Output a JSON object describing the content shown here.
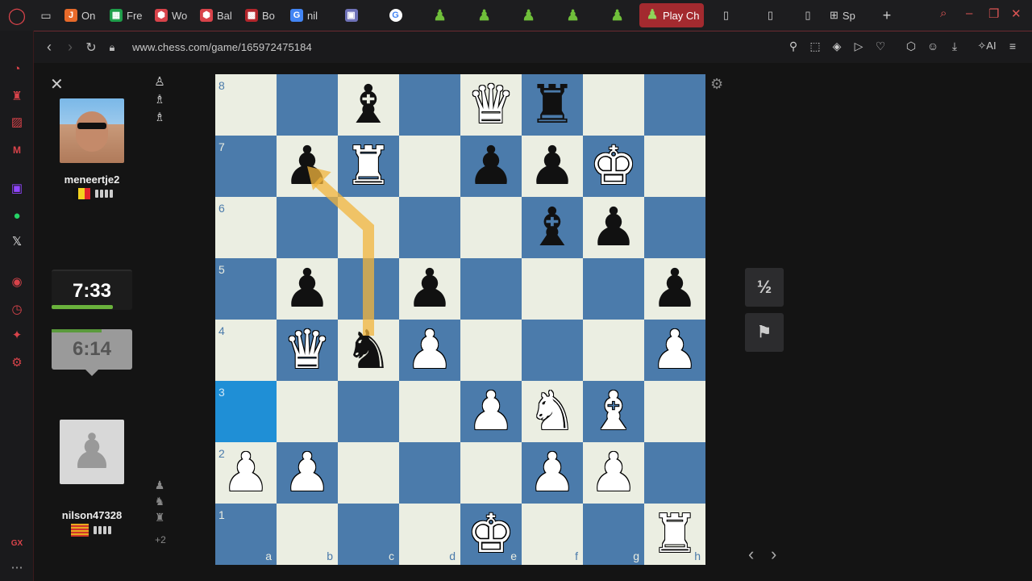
{
  "tabs": [
    {
      "label": "On",
      "icon": "jira-icon",
      "color": "#e86a2a",
      "glyph": "J"
    },
    {
      "label": "Fre",
      "icon": "sheet-icon",
      "color": "#1e9e4a",
      "glyph": "▦"
    },
    {
      "label": "Wo",
      "icon": "red-hex-icon",
      "color": "#d8434a",
      "glyph": "⬢"
    },
    {
      "label": "Bal",
      "icon": "red-hex-icon",
      "color": "#d8434a",
      "glyph": "⬢"
    },
    {
      "label": "Bo",
      "icon": "checker-icon",
      "color": "#b3262c",
      "glyph": "▩"
    },
    {
      "label": "nil",
      "icon": "google-icon",
      "color": "#4285f4",
      "glyph": "G"
    }
  ],
  "active_tab": {
    "label": "Play Ch"
  },
  "spaces_tab": {
    "label": "Sp"
  },
  "address": {
    "url": "www.chess.com/game/165972475184"
  },
  "toolbar": {
    "ai_label": "AI"
  },
  "top_player": {
    "name": "meneertje2",
    "clock": "7:33"
  },
  "bottom_player": {
    "name": "nilson47328",
    "clock": "6:14",
    "captures_extra": "+2"
  },
  "draw_label": "½",
  "colors": {
    "light_square": "#ebeee2",
    "dark_square": "#4b7bab",
    "highlight": "#1f8fd6",
    "arrow": "#f2b43c",
    "accent": "#d8434a"
  },
  "board": {
    "rank_labels": [
      "8",
      "7",
      "6",
      "5",
      "4",
      "3",
      "2",
      "1"
    ],
    "file_labels": [
      "a",
      "b",
      "c",
      "d",
      "e",
      "f",
      "g",
      "h"
    ],
    "pieces": [
      {
        "sq": "c8",
        "piece": "bishop",
        "color": "black"
      },
      {
        "sq": "e8",
        "piece": "queen",
        "color": "white"
      },
      {
        "sq": "f8",
        "piece": "rook",
        "color": "black"
      },
      {
        "sq": "b7",
        "piece": "pawn",
        "color": "black"
      },
      {
        "sq": "c7",
        "piece": "rook",
        "color": "white"
      },
      {
        "sq": "e7",
        "piece": "pawn",
        "color": "black"
      },
      {
        "sq": "f7",
        "piece": "pawn",
        "color": "black"
      },
      {
        "sq": "g7",
        "piece": "king",
        "color": "white"
      },
      {
        "sq": "f6",
        "piece": "bishop",
        "color": "black"
      },
      {
        "sq": "g6",
        "piece": "pawn",
        "color": "black"
      },
      {
        "sq": "b5",
        "piece": "pawn",
        "color": "black"
      },
      {
        "sq": "d5",
        "piece": "pawn",
        "color": "black"
      },
      {
        "sq": "h5",
        "piece": "pawn",
        "color": "black"
      },
      {
        "sq": "b4",
        "piece": "queen",
        "color": "white"
      },
      {
        "sq": "c4",
        "piece": "knight",
        "color": "black"
      },
      {
        "sq": "d4",
        "piece": "pawn",
        "color": "white"
      },
      {
        "sq": "h4",
        "piece": "pawn",
        "color": "white"
      },
      {
        "sq": "e3",
        "piece": "pawn",
        "color": "white"
      },
      {
        "sq": "f3",
        "piece": "knight",
        "color": "white"
      },
      {
        "sq": "g3",
        "piece": "bishop",
        "color": "white"
      },
      {
        "sq": "a2",
        "piece": "pawn",
        "color": "white"
      },
      {
        "sq": "b2",
        "piece": "pawn",
        "color": "white"
      },
      {
        "sq": "f2",
        "piece": "pawn",
        "color": "white"
      },
      {
        "sq": "g2",
        "piece": "pawn",
        "color": "white"
      },
      {
        "sq": "e1",
        "piece": "king",
        "color": "white"
      },
      {
        "sq": "h1",
        "piece": "rook",
        "color": "white"
      }
    ],
    "highlighted": [
      "a3"
    ],
    "arrow": {
      "from": "c4",
      "via": "c6",
      "to": "b7"
    }
  }
}
